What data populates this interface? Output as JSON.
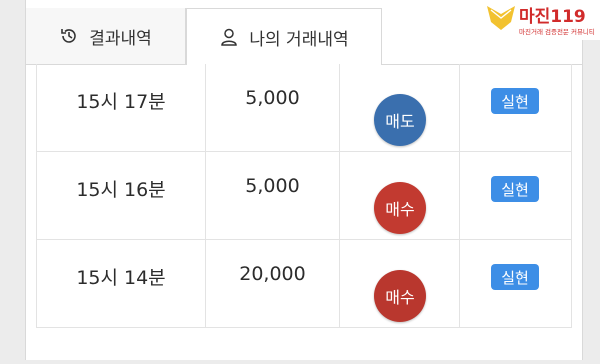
{
  "tabs": [
    {
      "label": "결과내역",
      "icon": "history-icon"
    },
    {
      "label": "나의 거래내역",
      "icon": "user-icon"
    }
  ],
  "logo": {
    "main": "마진119",
    "sub": "마진거래 검증전문 커뮤니티"
  },
  "rows": [
    {
      "time": "15시 17분",
      "amount": "5,000",
      "action": "매도",
      "action_color": "#3a6fae",
      "status": "실현"
    },
    {
      "time": "15시 16분",
      "amount": "5,000",
      "action": "매수",
      "action_color": "#c23a30",
      "status": "실현"
    },
    {
      "time": "15시 14분",
      "amount": "20,000",
      "action": "매수",
      "action_color": "#b9372e",
      "status": "실현"
    }
  ],
  "colors": {
    "badge": "#3d8ee6",
    "sell": "#3a6fae",
    "buy": "#c23a30"
  }
}
